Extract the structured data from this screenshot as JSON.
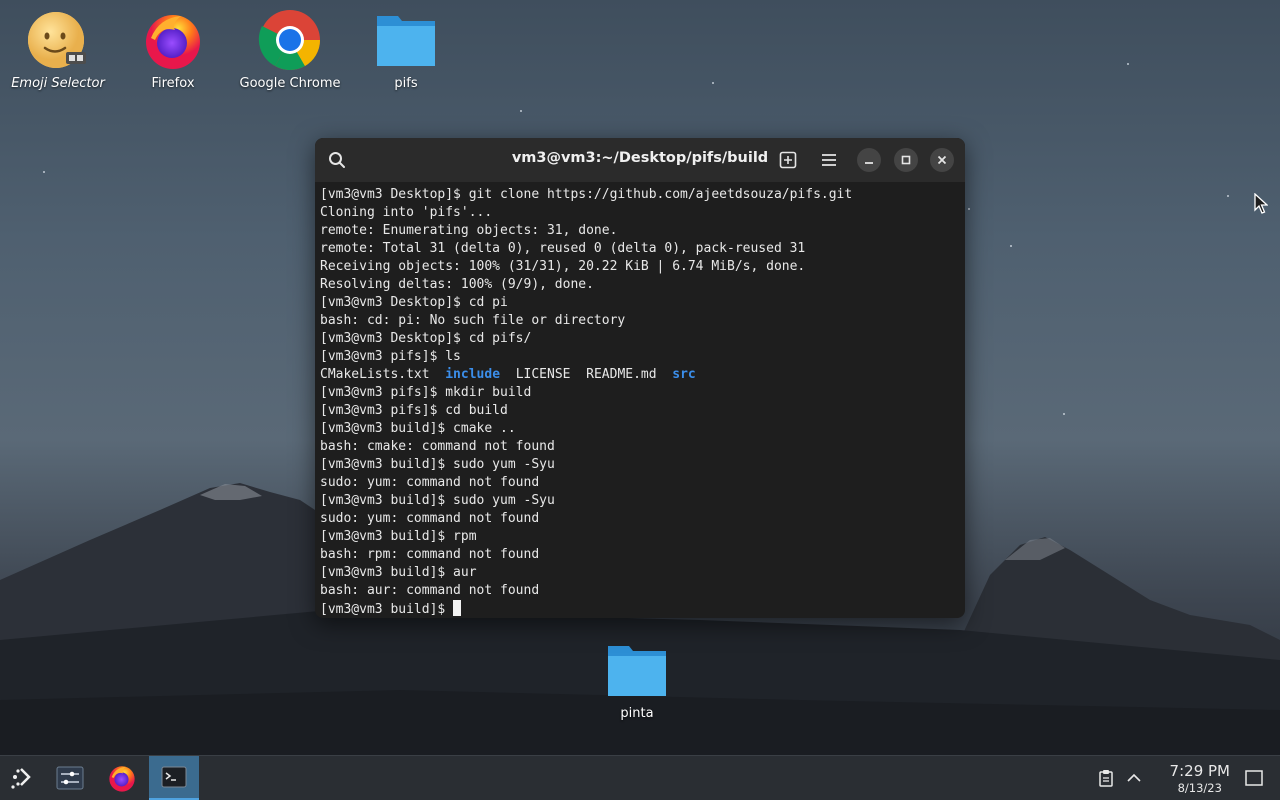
{
  "desktop": {
    "icons": [
      {
        "label": "Emoji Selector"
      },
      {
        "label": "Firefox"
      },
      {
        "label": "Google Chrome"
      },
      {
        "label": "pifs"
      },
      {
        "label": "pinta"
      }
    ]
  },
  "terminal": {
    "title": "vm3@vm3:~/Desktop/pifs/build",
    "lines": [
      "[vm3@vm3 Desktop]$ git clone https://github.com/ajeetdsouza/pifs.git",
      "Cloning into 'pifs'...",
      "remote: Enumerating objects: 31, done.",
      "remote: Total 31 (delta 0), reused 0 (delta 0), pack-reused 31",
      "Receiving objects: 100% (31/31), 20.22 KiB | 6.74 MiB/s, done.",
      "Resolving deltas: 100% (9/9), done.",
      "[vm3@vm3 Desktop]$ cd pi",
      "bash: cd: pi: No such file or directory",
      "[vm3@vm3 Desktop]$ cd pifs/",
      "[vm3@vm3 pifs]$ ls"
    ],
    "ls_output": {
      "file1": "CMakeLists.txt",
      "dir1": "include",
      "file2": "LICENSE",
      "file3": "README.md",
      "dir2": "src"
    },
    "lines2": [
      "[vm3@vm3 pifs]$ mkdir build",
      "[vm3@vm3 pifs]$ cd build",
      "[vm3@vm3 build]$ cmake ..",
      "bash: cmake: command not found",
      "[vm3@vm3 build]$ sudo yum -Syu",
      "sudo: yum: command not found",
      "[vm3@vm3 build]$ sudo yum -Syu",
      "sudo: yum: command not found",
      "[vm3@vm3 build]$ rpm",
      "bash: rpm: command not found",
      "[vm3@vm3 build]$ aur",
      "bash: aur: command not found"
    ],
    "prompt": "[vm3@vm3 build]$ "
  },
  "taskbar": {
    "time": "7:29 PM",
    "date": "8/13/23"
  },
  "colors": {
    "accent": "#3b8eea",
    "taskbar_active": "#3b6b8f"
  }
}
